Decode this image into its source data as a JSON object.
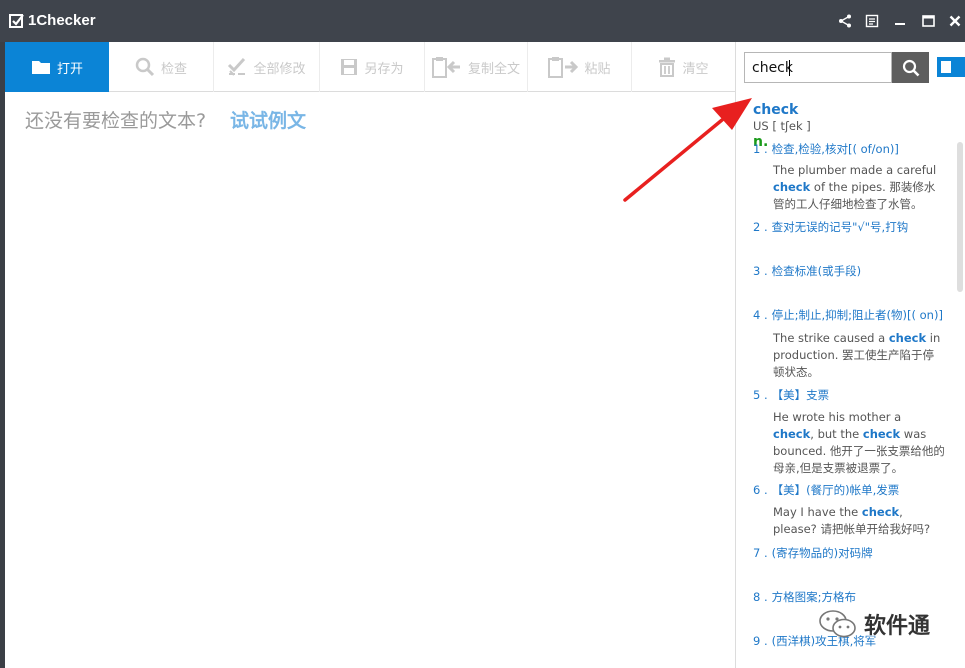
{
  "app": {
    "title": "1Checker"
  },
  "toolbar": [
    {
      "label": "打开",
      "icon": "folder-icon",
      "active": true
    },
    {
      "label": "检查",
      "icon": "magnifier-icon"
    },
    {
      "label": "全部修改",
      "icon": "check-all-icon"
    },
    {
      "label": "另存为",
      "icon": "save-icon"
    },
    {
      "label": "复制全文",
      "icon": "copy-icon"
    },
    {
      "label": "粘贴",
      "icon": "paste-icon"
    },
    {
      "label": "清空",
      "icon": "trash-icon"
    }
  ],
  "editor": {
    "empty_hint": "还没有要检查的文本?",
    "try_sample": "试试例文"
  },
  "search": {
    "value": "check"
  },
  "dictionary": {
    "word": "check",
    "phonetic": "US [ tʃek ]",
    "pos": "n.",
    "senses": [
      {
        "num": "1 .",
        "text": "检查,检验,核对[( of/on)]",
        "example": [
          {
            "t": "The plumber made a careful "
          },
          {
            "t": "check",
            "hl": true
          },
          {
            "t": " of the pipes.  那装修水管的工人仔细地检查了水管。"
          }
        ]
      },
      {
        "num": "2 .",
        "text": "查对无误的记号\"√\"号,打钩"
      },
      {
        "num": "3 .",
        "text": "检查标准(或手段)"
      },
      {
        "num": "4 .",
        "text": "停止;制止,抑制;阻止者(物)[( on)]",
        "example": [
          {
            "t": "The strike caused a "
          },
          {
            "t": "check",
            "hl": true
          },
          {
            "t": " in production.  罢工使生产陷于停顿状态。"
          }
        ]
      },
      {
        "num": "5 .",
        "text": "【美】支票",
        "example": [
          {
            "t": "He wrote his mother a "
          },
          {
            "t": "check",
            "hl": true
          },
          {
            "t": ", but the "
          },
          {
            "t": "check",
            "hl": true
          },
          {
            "t": " was bounced. 他开了一张支票给他的母亲,但是支票被退票了。"
          }
        ]
      },
      {
        "num": "6 .",
        "text": "【美】(餐厅的)帐单,发票",
        "example": [
          {
            "t": "May I have the "
          },
          {
            "t": "check",
            "hl": true
          },
          {
            "t": ", please? 请把帐单开给我好吗?"
          }
        ]
      },
      {
        "num": "7 .",
        "text": "(寄存物品的)对码牌"
      },
      {
        "num": "8 .",
        "text": "方格图案;方格布"
      },
      {
        "num": "9 .",
        "text": "(西洋棋)攻王棋,将军"
      }
    ]
  },
  "watermark": {
    "text": "软件通"
  },
  "colors": {
    "accent": "#0b84d6",
    "titlebar": "#3f444c",
    "annotation": "#e8201f"
  }
}
